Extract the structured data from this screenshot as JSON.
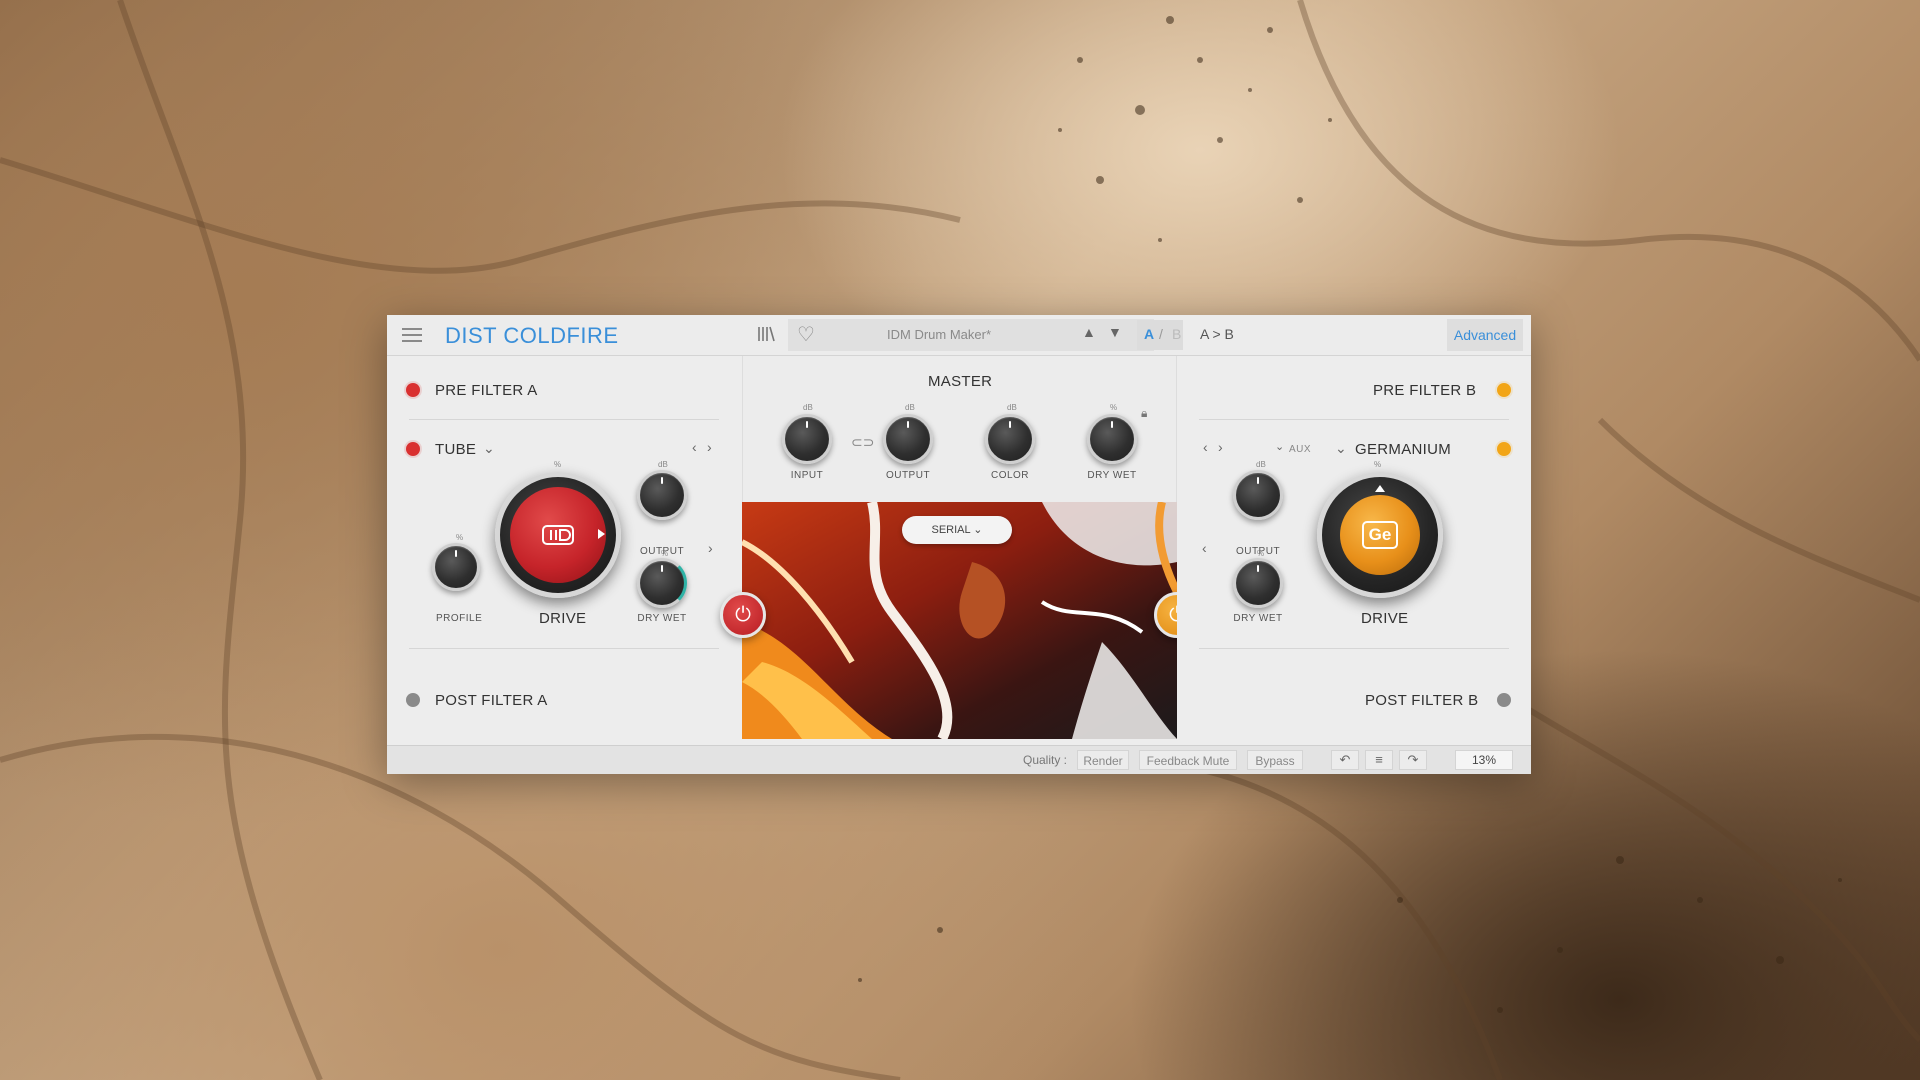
{
  "colors": {
    "accent_blue": "#3a8fd9",
    "red_led": "#d93030",
    "orange_led": "#f2a516",
    "red_knob": "#c6242a",
    "orange_knob": "#e8901a"
  },
  "header": {
    "title": "DIST COLDFIRE",
    "library_icon": "library-icon",
    "favorite_icon": "heart-icon",
    "preset_name": "IDM Drum Maker*",
    "prev_arrow": "▲",
    "next_arrow": "▼",
    "ab_a": "A",
    "ab_slash": "/",
    "ab_b": "B",
    "ab_copy": "A > B",
    "advanced_label": "Advanced"
  },
  "left": {
    "pre_filter": "PRE FILTER A",
    "type_label": "TUBE",
    "drive_label": "DRIVE",
    "profile_label": "PROFILE",
    "output_label": "OUTPUT",
    "drywet_label": "DRY WET",
    "post_filter": "POST FILTER A",
    "percent_unit": "%",
    "db_unit": "dB"
  },
  "master": {
    "title": "MASTER",
    "input_label": "INPUT",
    "output_label": "OUTPUT",
    "color_label": "COLOR",
    "drywet_label": "DRY  WET",
    "db_unit": "dB",
    "percent_unit": "%",
    "routing": "SERIAL"
  },
  "right": {
    "pre_filter": "PRE FILTER B",
    "aux_label": "AUX",
    "type_label": "GERMANIUM",
    "output_label": "OUTPUT",
    "drywet_label": "DRY WET",
    "drive_label": "DRIVE",
    "post_filter": "POST FILTER B",
    "core_text": "Ge",
    "db_unit": "dB",
    "percent_unit": "%"
  },
  "bottombar": {
    "quality_label": "Quality :",
    "render": "Render",
    "feedback_mute": "Feedback Mute",
    "bypass": "Bypass",
    "undo_icon": "↶",
    "list_icon": "≡",
    "redo_icon": "↷",
    "cpu": "13%"
  }
}
